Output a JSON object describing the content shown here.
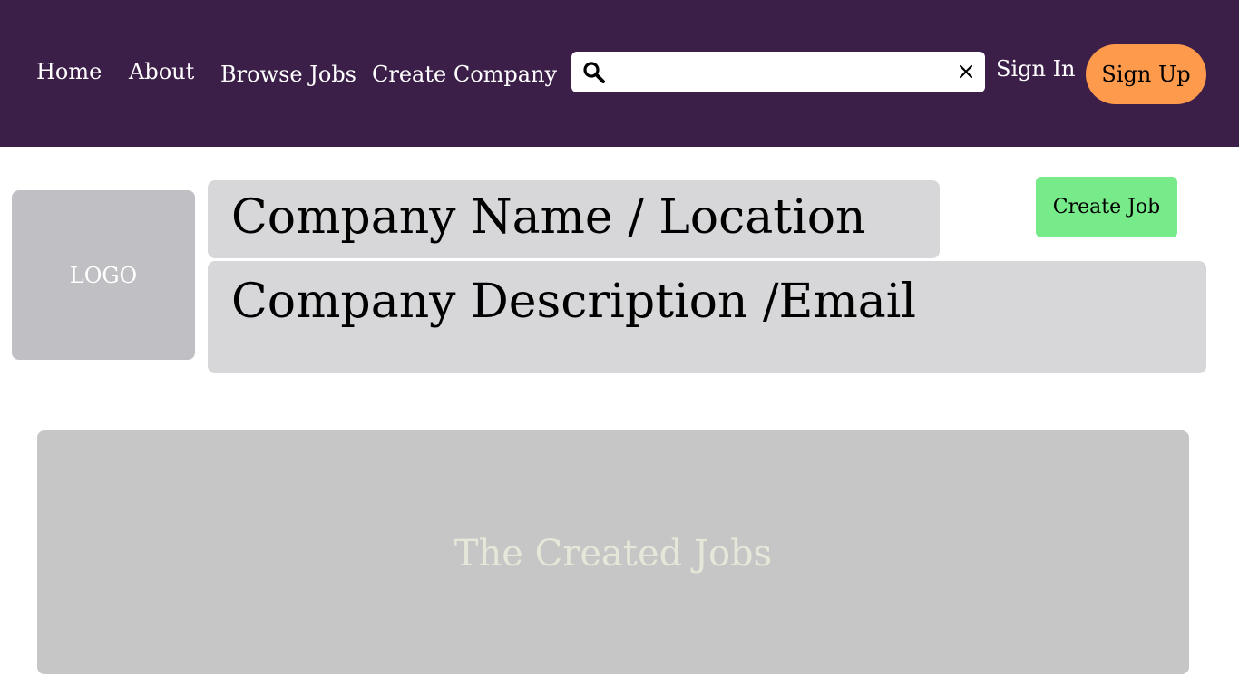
{
  "nav": {
    "home_label": "Home",
    "about_label": "About",
    "browse_jobs_label": "Browse Jobs",
    "create_company_label": "Create Company",
    "sign_in_label": "Sign In",
    "sign_up_label": "Sign Up"
  },
  "search": {
    "value": "",
    "placeholder": ""
  },
  "company": {
    "logo_label": "LOGO",
    "name_location": "Company Name / Location",
    "description_email": "Company Description /Email",
    "create_job_label": "Create Job"
  },
  "jobs": {
    "panel_label": "The Created Jobs"
  },
  "colors": {
    "navbar_bg": "#3c1f48",
    "sign_up_bg": "#fd9a4c",
    "create_job_bg": "#77ea8a",
    "info_box_bg": "#d7d7d9",
    "logo_bg": "#c0bfc4",
    "jobs_panel_bg": "#c6c6c6"
  },
  "icons": {
    "search": "search-icon",
    "clear": "close-icon"
  }
}
